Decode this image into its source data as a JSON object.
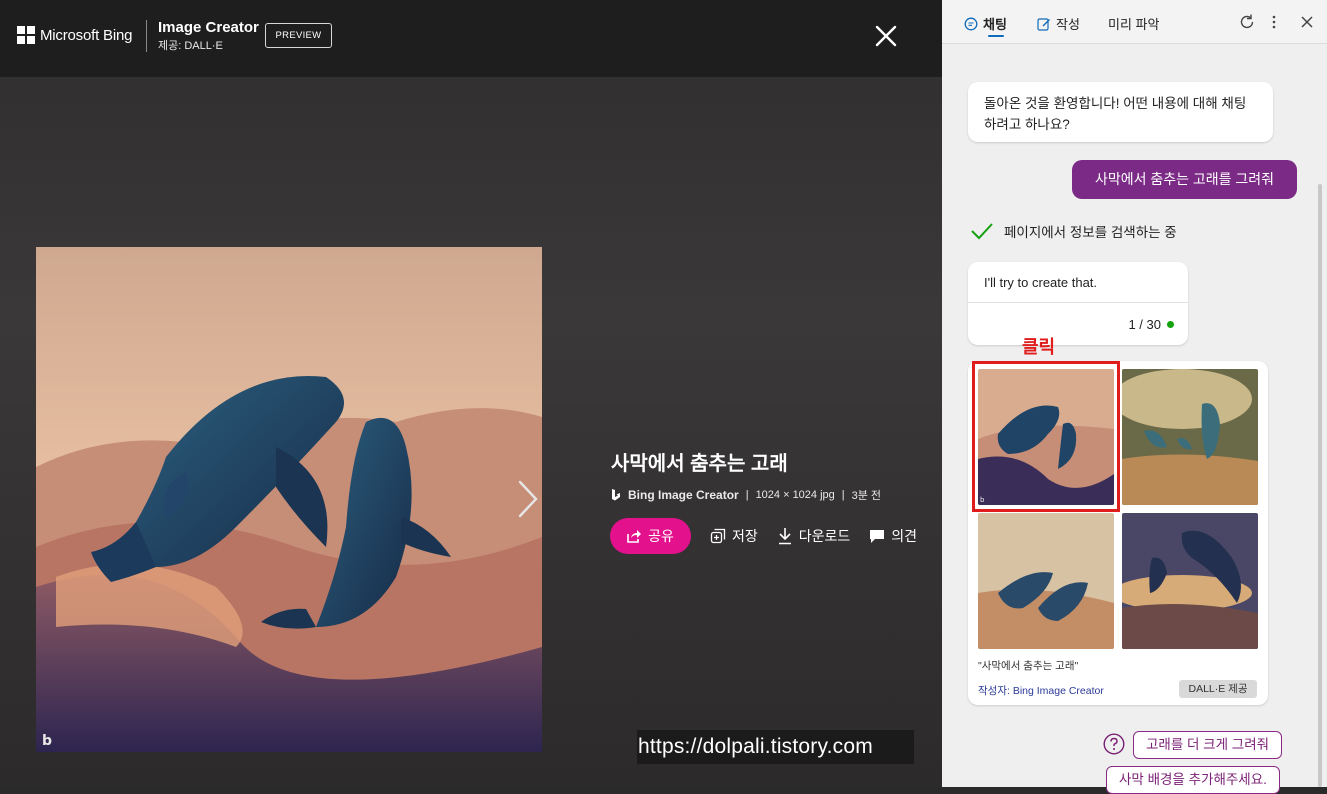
{
  "header": {
    "brand": "Microsoft Bing",
    "product_title": "Image Creator",
    "product_sub": "제공: DALL·E",
    "preview_label": "PREVIEW"
  },
  "viewer": {
    "title": "사막에서 춤추는 고래",
    "meta": {
      "source": "Bing Image Creator",
      "sep1": "|",
      "dims": "1024 × 1024 jpg",
      "sep2": "|",
      "age": "3분 전"
    },
    "actions": {
      "share": "공유",
      "save": "저장",
      "download": "다운로드",
      "feedback": "의견"
    },
    "watermark": "https://dolpali.tistory.com"
  },
  "panel": {
    "tabs": [
      {
        "label": "채팅"
      },
      {
        "label": "작성"
      },
      {
        "label": "미리 파악"
      }
    ],
    "greeting": "돌아온 것을 환영합니다! 어떤 내용에 대해 채팅하려고 하나요?",
    "user_message": "사막에서 춤추는 고래를 그려줘",
    "search_status": "페이지에서 정보를 검색하는 중",
    "reply": "I'll try to create that.",
    "counter": "1 / 30",
    "annotation": "클릭",
    "prompt_quote": "\"사막에서 춤추는 고래\"",
    "creator": "작성자: Bing Image Creator",
    "badge": "DALL·E 제공",
    "suggestions": [
      "고래를 더 크게 그려줘",
      "사막 배경을 추가해주세요."
    ]
  },
  "colors": {
    "accent_pink": "#e3128c",
    "user_bubble": "#7b2a86",
    "annotation_red": "#e01c1c",
    "status_green": "#13a10e"
  }
}
